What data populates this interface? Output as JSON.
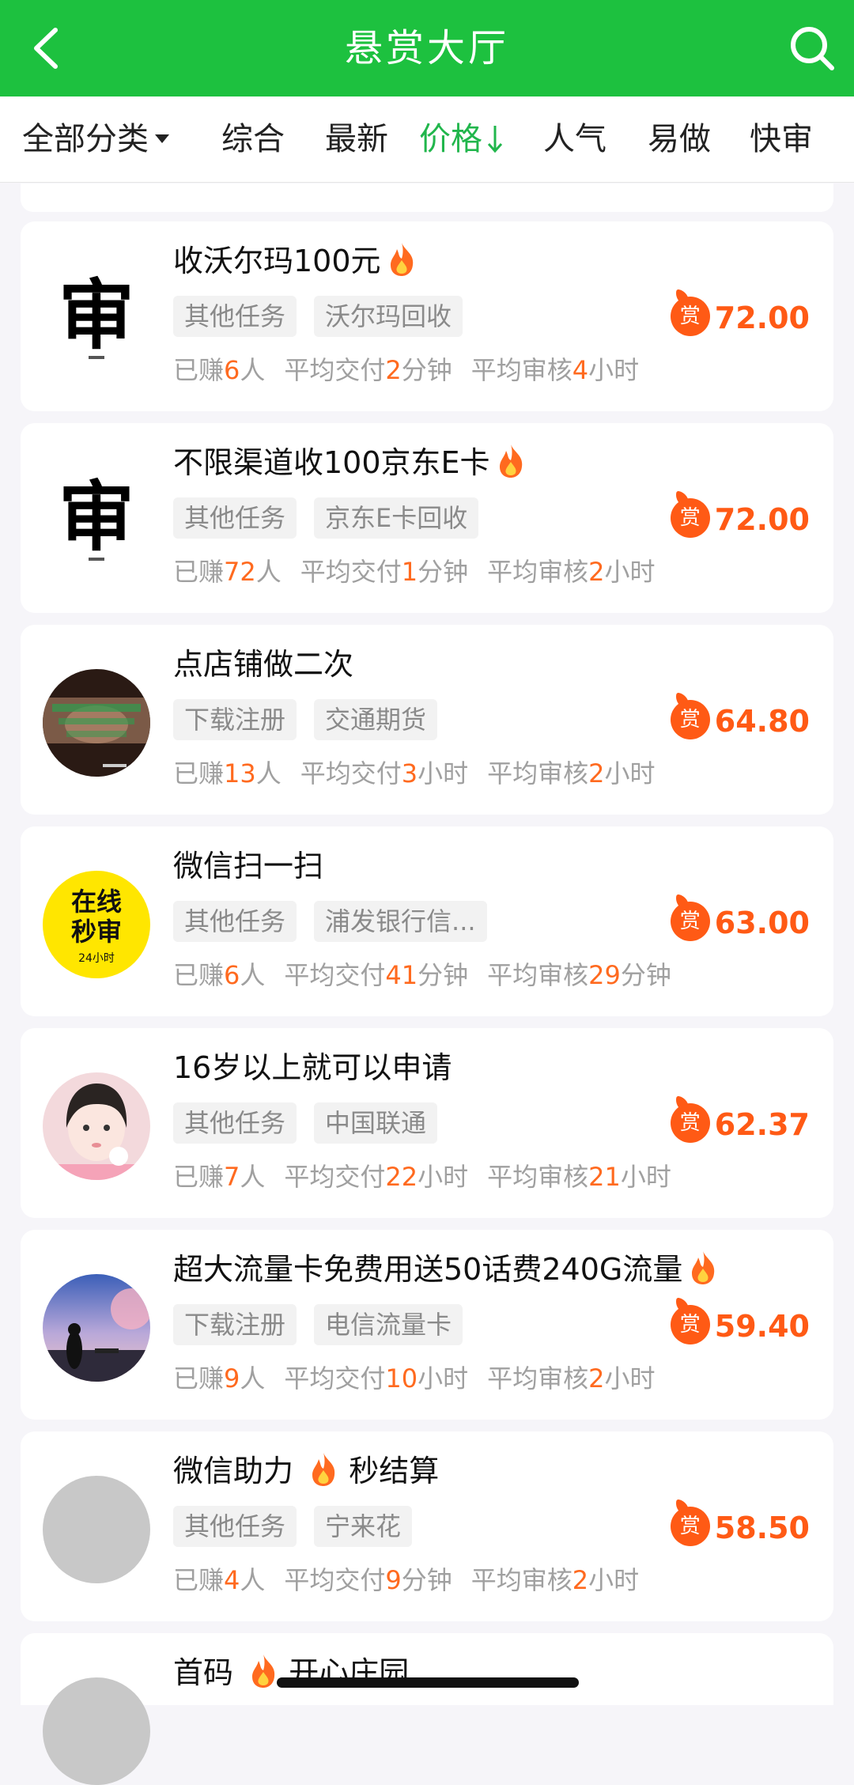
{
  "header": {
    "title": "悬赏大厅"
  },
  "filters": {
    "category": "全部分类",
    "items": [
      "综合",
      "最新",
      "价格",
      "人气",
      "易做",
      "快审"
    ],
    "active_index": 2
  },
  "tasks": [
    {
      "title": "收沃尔玛100元",
      "hot": true,
      "tags": [
        "其他任务",
        "沃尔玛回收"
      ],
      "earned_label": "已赚",
      "earned": "6",
      "earned_unit": "人",
      "deliver_label": "平均交付",
      "deliver": "2",
      "deliver_unit": "分钟",
      "review_label": "平均审核",
      "review": "4",
      "review_unit": "小时",
      "badge": "赏",
      "price": "72.00",
      "avatar": "calligraphy-shen"
    },
    {
      "title": "不限渠道收100京东E卡",
      "hot": true,
      "tags": [
        "其他任务",
        "京东E卡回收"
      ],
      "earned_label": "已赚",
      "earned": "72",
      "earned_unit": "人",
      "deliver_label": "平均交付",
      "deliver": "1",
      "deliver_unit": "分钟",
      "review_label": "平均审核",
      "review": "2",
      "review_unit": "小时",
      "badge": "赏",
      "price": "72.00",
      "avatar": "calligraphy-shen"
    },
    {
      "title": "点店铺做二次",
      "hot": false,
      "tags": [
        "下载注册",
        "交通期货"
      ],
      "earned_label": "已赚",
      "earned": "13",
      "earned_unit": "人",
      "deliver_label": "平均交付",
      "deliver": "3",
      "deliver_unit": "小时",
      "review_label": "平均审核",
      "review": "2",
      "review_unit": "小时",
      "badge": "赏",
      "price": "64.80",
      "avatar": "photo-dark"
    },
    {
      "title": "微信扫一扫",
      "hot": false,
      "tags": [
        "其他任务",
        "浦发银行信..."
      ],
      "earned_label": "已赚",
      "earned": "6",
      "earned_unit": "人",
      "deliver_label": "平均交付",
      "deliver": "41",
      "deliver_unit": "分钟",
      "review_label": "平均审核",
      "review": "29",
      "review_unit": "分钟",
      "badge": "赏",
      "price": "63.00",
      "avatar": "yellow-seal",
      "avatar_text": {
        "line1": "在线",
        "line2": "秒审",
        "line3": "24小时"
      }
    },
    {
      "title": "16岁以上就可以申请",
      "hot": false,
      "tags": [
        "其他任务",
        "中国联通"
      ],
      "earned_label": "已赚",
      "earned": "7",
      "earned_unit": "人",
      "deliver_label": "平均交付",
      "deliver": "22",
      "deliver_unit": "小时",
      "review_label": "平均审核",
      "review": "21",
      "review_unit": "小时",
      "badge": "赏",
      "price": "62.37",
      "avatar": "photo-girl"
    },
    {
      "title": "超大流量卡免费用送50话费240G流量",
      "hot": true,
      "tags": [
        "下载注册",
        "电信流量卡"
      ],
      "earned_label": "已赚",
      "earned": "9",
      "earned_unit": "人",
      "deliver_label": "平均交付",
      "deliver": "10",
      "deliver_unit": "小时",
      "review_label": "平均审核",
      "review": "2",
      "review_unit": "小时",
      "badge": "赏",
      "price": "59.40",
      "avatar": "photo-sunset"
    },
    {
      "title": "微信助力",
      "title_suffix": "秒结算",
      "hot_inline": true,
      "tags": [
        "其他任务",
        "宁来花"
      ],
      "earned_label": "已赚",
      "earned": "4",
      "earned_unit": "人",
      "deliver_label": "平均交付",
      "deliver": "9",
      "deliver_unit": "分钟",
      "review_label": "平均审核",
      "review": "2",
      "review_unit": "小时",
      "badge": "赏",
      "price": "58.50",
      "avatar": "gray-placeholder"
    },
    {
      "title": "首码",
      "title_suffix": "开心庄园",
      "hot_inline": true,
      "avatar": "gray-placeholder"
    }
  ],
  "colors": {
    "brand_green": "#1dc13f",
    "active_filter": "#21b64c",
    "reward_orange": "#ff5a15",
    "number_orange": "#ff6a1f"
  }
}
